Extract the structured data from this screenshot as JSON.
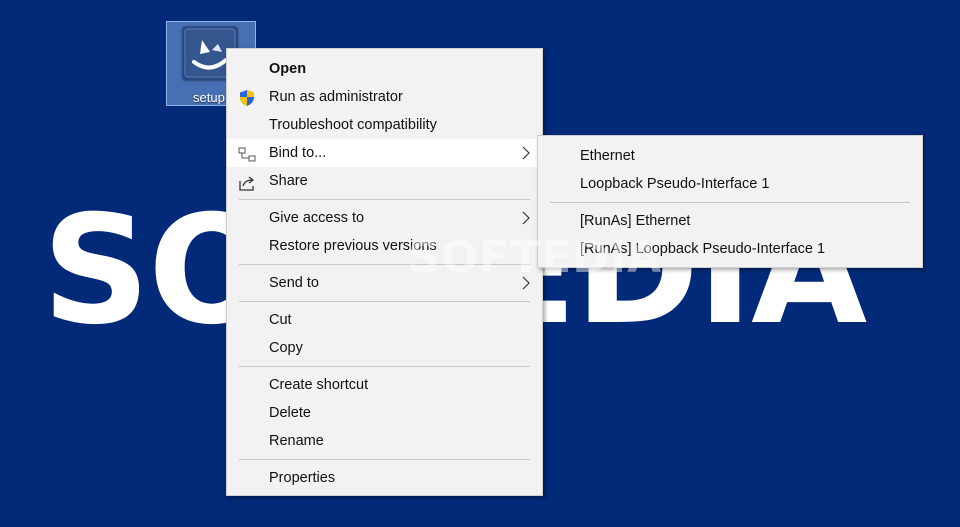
{
  "desktop": {
    "watermark_large": "SOFTEDIA",
    "watermark_small": "SOFTEDIA",
    "icon": {
      "name": "setup-app-icon",
      "label": "setup"
    }
  },
  "context_menu": {
    "items": [
      {
        "id": "open",
        "label": "Open",
        "bold": true
      },
      {
        "id": "run-as-admin",
        "label": "Run as administrator",
        "icon": "uac-shield-icon"
      },
      {
        "id": "troubleshoot",
        "label": "Troubleshoot compatibility"
      },
      {
        "id": "bind-to",
        "label": "Bind to...",
        "icon": "network-bind-icon",
        "submenu": true,
        "highlighted": true
      },
      {
        "id": "share",
        "label": "Share",
        "icon": "share-icon"
      },
      {
        "id": "give-access",
        "label": "Give access to",
        "submenu": true
      },
      {
        "id": "restore-versions",
        "label": "Restore previous versions"
      },
      {
        "id": "send-to",
        "label": "Send to",
        "submenu": true
      },
      {
        "id": "cut",
        "label": "Cut"
      },
      {
        "id": "copy",
        "label": "Copy"
      },
      {
        "id": "create-shortcut",
        "label": "Create shortcut"
      },
      {
        "id": "delete",
        "label": "Delete"
      },
      {
        "id": "rename",
        "label": "Rename"
      },
      {
        "id": "properties",
        "label": "Properties"
      }
    ]
  },
  "bind_submenu": {
    "items": [
      {
        "id": "ethernet",
        "label": "Ethernet"
      },
      {
        "id": "loopback",
        "label": "Loopback Pseudo-Interface 1"
      },
      {
        "id": "runas-ethernet",
        "label": "[RunAs] Ethernet"
      },
      {
        "id": "runas-loopback",
        "label": "[RunAs] Loopback Pseudo-Interface 1"
      }
    ]
  },
  "colors": {
    "desktop_background": "#022a78",
    "menu_background": "#f2f2f2",
    "menu_highlight": "#ffffff",
    "separator": "#c8c8c8"
  }
}
